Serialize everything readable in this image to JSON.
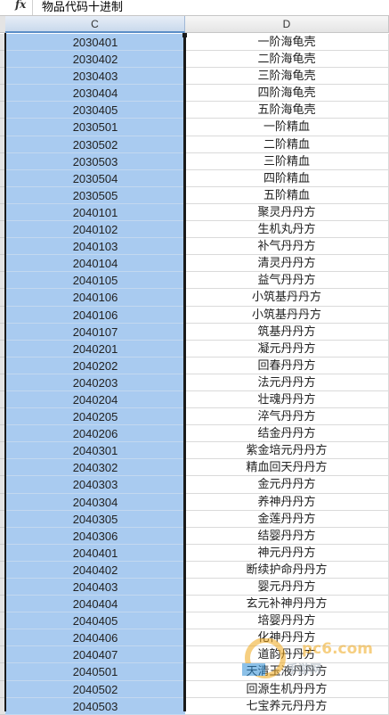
{
  "formula_bar": {
    "fx_label": "fx",
    "content": "物品代码十进制"
  },
  "columns": [
    "C",
    "D"
  ],
  "rows": [
    {
      "code": "2030401",
      "name": "一阶海龟壳"
    },
    {
      "code": "2030402",
      "name": "二阶海龟壳"
    },
    {
      "code": "2030403",
      "name": "三阶海龟壳"
    },
    {
      "code": "2030404",
      "name": "四阶海龟壳"
    },
    {
      "code": "2030405",
      "name": "五阶海龟壳"
    },
    {
      "code": "2030501",
      "name": "一阶精血"
    },
    {
      "code": "2030502",
      "name": "二阶精血"
    },
    {
      "code": "2030503",
      "name": "三阶精血"
    },
    {
      "code": "2030504",
      "name": "四阶精血"
    },
    {
      "code": "2030505",
      "name": "五阶精血"
    },
    {
      "code": "2040101",
      "name": "聚灵丹丹方"
    },
    {
      "code": "2040102",
      "name": "生机丸丹方"
    },
    {
      "code": "2040103",
      "name": "补气丹丹方"
    },
    {
      "code": "2040104",
      "name": "清灵丹丹方"
    },
    {
      "code": "2040105",
      "name": "益气丹丹方"
    },
    {
      "code": "2040106",
      "name": "小筑基丹丹方"
    },
    {
      "code": "2040106",
      "name": "小筑基丹丹方"
    },
    {
      "code": "2040107",
      "name": "筑基丹丹方"
    },
    {
      "code": "2040201",
      "name": "凝元丹丹方"
    },
    {
      "code": "2040202",
      "name": "回春丹丹方"
    },
    {
      "code": "2040203",
      "name": "法元丹丹方"
    },
    {
      "code": "2040204",
      "name": "壮魂丹丹方"
    },
    {
      "code": "2040205",
      "name": "淬气丹丹方"
    },
    {
      "code": "2040206",
      "name": "结金丹丹方"
    },
    {
      "code": "2040301",
      "name": "紫金培元丹丹方"
    },
    {
      "code": "2040302",
      "name": "精血回天丹丹方"
    },
    {
      "code": "2040303",
      "name": "金元丹丹方"
    },
    {
      "code": "2040304",
      "name": "养神丹丹方"
    },
    {
      "code": "2040305",
      "name": "金莲丹丹方"
    },
    {
      "code": "2040306",
      "name": "结婴丹丹方"
    },
    {
      "code": "2040401",
      "name": "神元丹丹方"
    },
    {
      "code": "2040402",
      "name": "断续护命丹丹方"
    },
    {
      "code": "2040403",
      "name": "婴元丹丹方"
    },
    {
      "code": "2040404",
      "name": "玄元补神丹丹方"
    },
    {
      "code": "2040405",
      "name": "培婴丹丹方"
    },
    {
      "code": "2040406",
      "name": "化神丹丹方"
    },
    {
      "code": "2040407",
      "name": "道韵丹丹方"
    },
    {
      "code": "2040501",
      "name": "天清玉液丹丹方"
    },
    {
      "code": "2040502",
      "name": "回源生机丹丹方"
    },
    {
      "code": "2040503",
      "name": "七宝养元丹丹方"
    }
  ],
  "watermark": {
    "brand": "pc6.com",
    "sub": "手游网"
  },
  "colors": {
    "selection_fill": "#a9cbf0",
    "selection_border": "#1a1a1a",
    "watermark_orange": "#f0a81c"
  }
}
